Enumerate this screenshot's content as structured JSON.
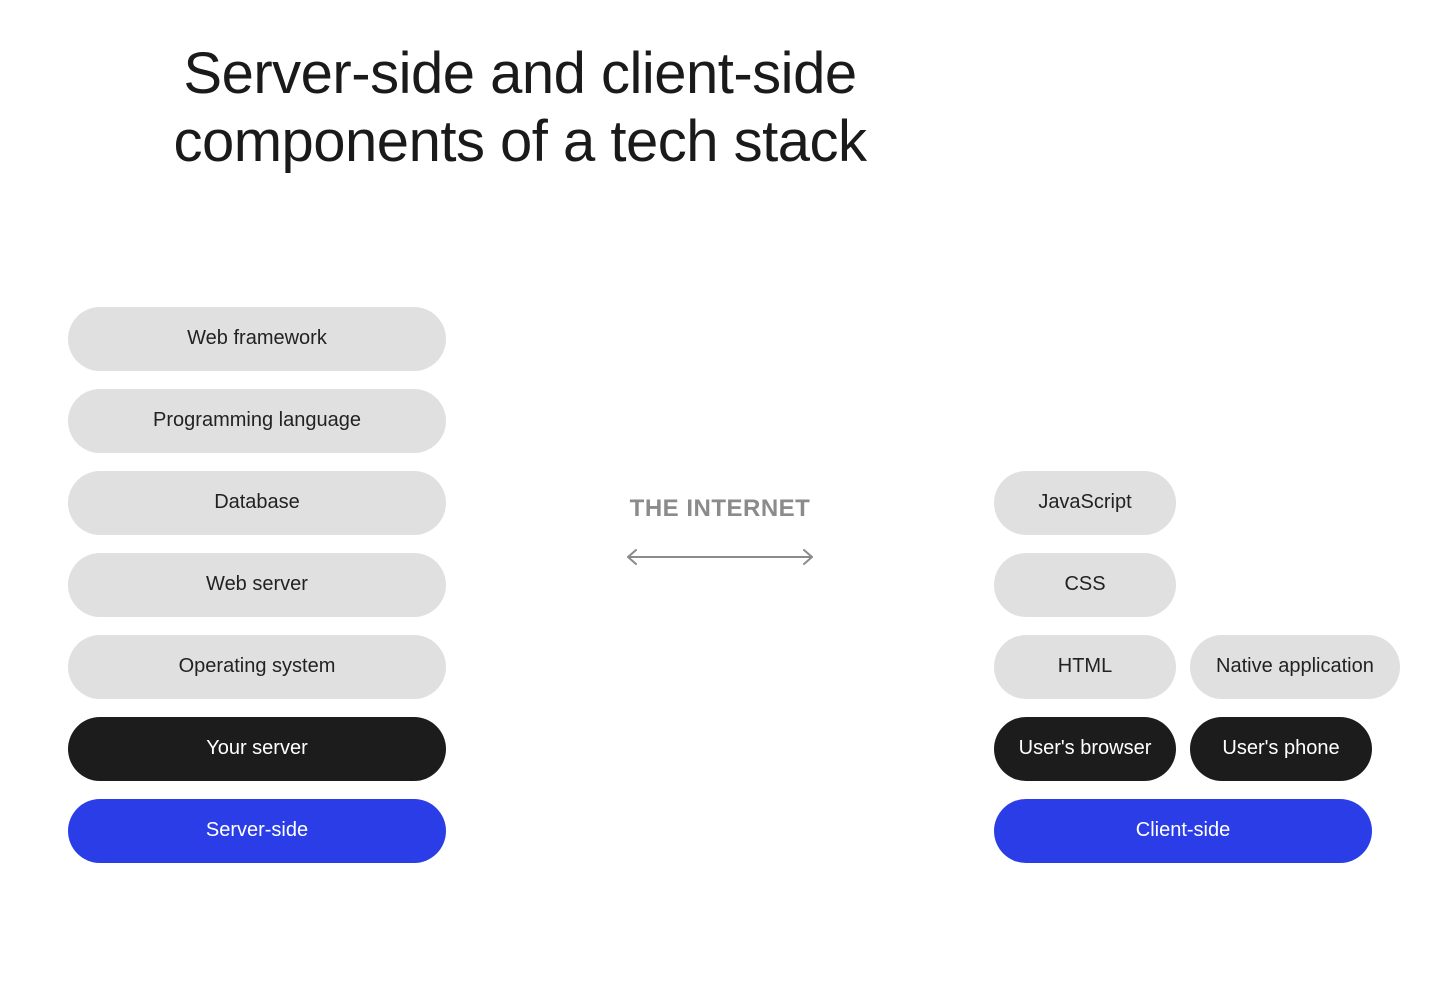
{
  "title": "Server-side and client-side components of a tech stack",
  "middle": {
    "label": "THE INTERNET"
  },
  "server": {
    "layers": [
      "Web framework",
      "Programming language",
      "Database",
      "Web server",
      "Operating system"
    ],
    "host": "Your server",
    "side": "Server-side"
  },
  "client": {
    "browser_stack": [
      "JavaScript",
      "CSS",
      "HTML"
    ],
    "native": "Native application",
    "hosts": [
      "User's browser",
      "User's phone"
    ],
    "side": "Client-side"
  }
}
